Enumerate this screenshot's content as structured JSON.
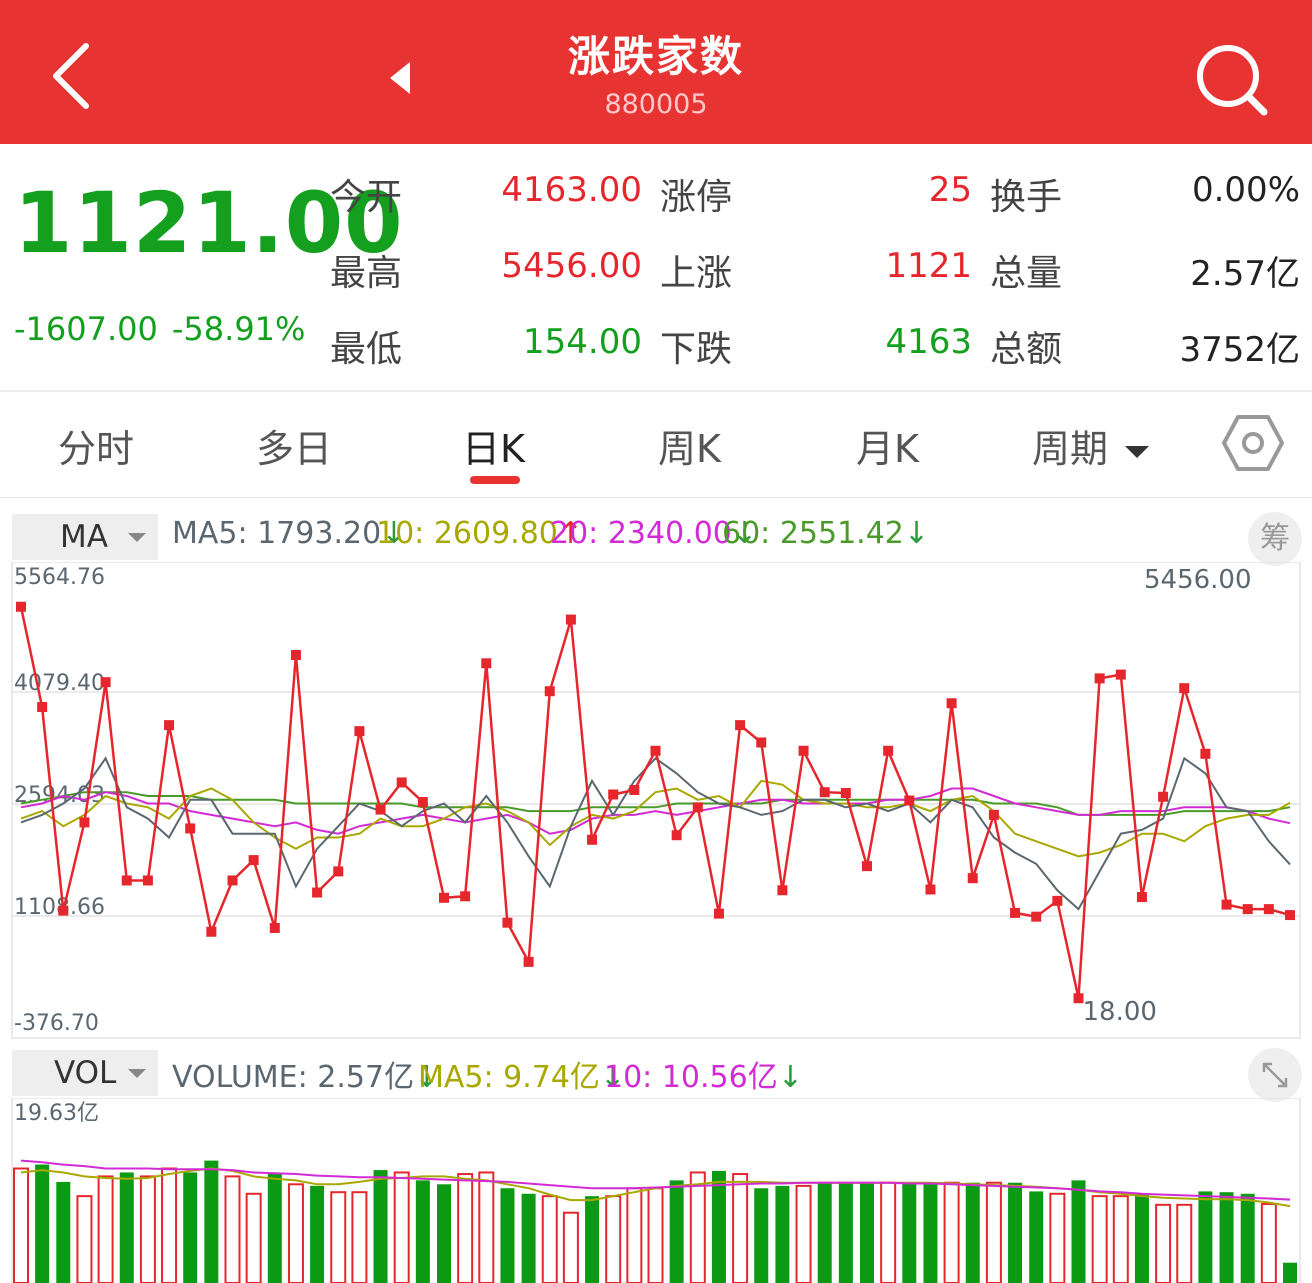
{
  "header": {
    "title": "涨跌家数",
    "code": "880005",
    "bg_color": "#e83333"
  },
  "quote": {
    "price": "1121.00",
    "change": "-1607.00",
    "change_pct": "-58.91%",
    "stats": [
      {
        "label": "今开",
        "value": "4163.00",
        "color": "red"
      },
      {
        "label": "最高",
        "value": "5456.00",
        "color": "red"
      },
      {
        "label": "最低",
        "value": "154.00",
        "color": "green"
      },
      {
        "label": "涨停",
        "value": "25",
        "color": "red"
      },
      {
        "label": "上涨",
        "value": "1121",
        "color": "red"
      },
      {
        "label": "下跌",
        "value": "4163",
        "color": "green"
      },
      {
        "label": "换手",
        "value": "0.00%",
        "color": "black"
      },
      {
        "label": "总量",
        "value": "2.57亿",
        "color": "black"
      },
      {
        "label": "总额",
        "value": "3752亿",
        "color": "black"
      }
    ]
  },
  "tabs": [
    {
      "label": "分时"
    },
    {
      "label": "多日"
    },
    {
      "label": "日K",
      "active": true
    },
    {
      "label": "周K"
    },
    {
      "label": "月K"
    },
    {
      "label": "周期"
    }
  ],
  "ma_bar": {
    "selector": "MA",
    "ma5": "MA5: 1793.20",
    "ma10": "10: 2609.80",
    "ma20": "20: 2340.00",
    "ma60": "60: 2551.42",
    "chip_button": "筹"
  },
  "vol_bar": {
    "selector": "VOL",
    "volume": "VOLUME: 2.57亿",
    "ma5": "MA5: 9.74亿",
    "ma10": "10: 10.56亿"
  },
  "icons": {
    "back": "back-icon",
    "prev": "triangle-left-icon",
    "search": "search-icon",
    "settings": "hexagon-settings-icon",
    "dropdown": "caret-down-icon",
    "expand": "expand-icon"
  },
  "chart_data": [
    {
      "type": "line",
      "title": "",
      "ylim": [
        -376.7,
        5564.76
      ],
      "y_ticks": [
        "5564.76",
        "4079.40",
        "2594.03",
        "1108.66",
        "-376.70"
      ],
      "annotations": {
        "max_label": "5456.00",
        "min_label": "18.00"
      },
      "colors": {
        "main": "#e5272d",
        "ma5": "#5b6770",
        "ma10": "#a8a800",
        "ma20": "#d22bd6",
        "ma60": "#4a9a2a"
      },
      "series": [
        {
          "name": "涨跌家数",
          "values": [
            5210,
            3880,
            1180,
            2350,
            4210,
            1580,
            1580,
            3640,
            2270,
            900,
            1580,
            1850,
            950,
            4570,
            1420,
            1700,
            3560,
            2520,
            2880,
            2620,
            1350,
            1370,
            4460,
            1020,
            500,
            4090,
            5040,
            2120,
            2720,
            2780,
            3300,
            2180,
            2550,
            1140,
            3640,
            3410,
            1450,
            3300,
            2750,
            2740,
            1770,
            3300,
            2640,
            1460,
            3930,
            1610,
            2450,
            1150,
            1100,
            1310,
            18,
            4260,
            4310,
            1360,
            2690,
            4130,
            3260,
            1260,
            1200,
            1200,
            1121
          ]
        },
        {
          "name": "MA5",
          "values": [
            2350,
            2450,
            2600,
            2800,
            3200,
            2550,
            2400,
            2150,
            2650,
            2650,
            2200,
            2200,
            2200,
            1500,
            2000,
            2300,
            2600,
            2500,
            2300,
            2500,
            2600,
            2350,
            2700,
            2350,
            1900,
            1500,
            2300,
            2900,
            2450,
            2900,
            3200,
            3000,
            2750,
            2600,
            2550,
            2450,
            2500,
            2650,
            2650,
            2550,
            2600,
            2500,
            2600,
            2350,
            2650,
            2550,
            2150,
            1950,
            1800,
            1450,
            1200,
            1700,
            2200,
            2250,
            2400,
            3200,
            3000,
            2550,
            2500,
            2100,
            1793.2
          ]
        },
        {
          "name": "MA10",
          "values": [
            2400,
            2500,
            2300,
            2450,
            2700,
            2600,
            2550,
            2400,
            2700,
            2800,
            2650,
            2350,
            2150,
            2000,
            2150,
            2150,
            2200,
            2400,
            2300,
            2300,
            2400,
            2550,
            2600,
            2500,
            2350,
            2050,
            2300,
            2450,
            2400,
            2500,
            2750,
            2800,
            2650,
            2700,
            2550,
            2900,
            2850,
            2650,
            2600,
            2600,
            2550,
            2550,
            2600,
            2500,
            2650,
            2700,
            2500,
            2200,
            2100,
            2000,
            1900,
            1950,
            2050,
            2200,
            2200,
            2100,
            2300,
            2400,
            2450,
            2450,
            2609.8
          ]
        },
        {
          "name": "MA20",
          "values": [
            2550,
            2600,
            2700,
            2650,
            2750,
            2700,
            2600,
            2600,
            2500,
            2450,
            2400,
            2350,
            2300,
            2350,
            2250,
            2200,
            2300,
            2350,
            2400,
            2450,
            2400,
            2350,
            2400,
            2450,
            2350,
            2200,
            2250,
            2400,
            2450,
            2450,
            2500,
            2450,
            2500,
            2550,
            2600,
            2650,
            2650,
            2600,
            2600,
            2600,
            2600,
            2650,
            2650,
            2700,
            2800,
            2800,
            2700,
            2600,
            2550,
            2500,
            2450,
            2450,
            2500,
            2500,
            2500,
            2550,
            2550,
            2550,
            2500,
            2400,
            2340.0
          ]
        },
        {
          "name": "MA60",
          "values": [
            2600,
            2650,
            2700,
            2750,
            2750,
            2750,
            2700,
            2700,
            2700,
            2650,
            2650,
            2650,
            2650,
            2600,
            2600,
            2600,
            2600,
            2600,
            2600,
            2550,
            2550,
            2550,
            2550,
            2550,
            2500,
            2500,
            2500,
            2550,
            2550,
            2550,
            2550,
            2600,
            2600,
            2600,
            2600,
            2600,
            2650,
            2650,
            2650,
            2650,
            2650,
            2650,
            2650,
            2650,
            2650,
            2650,
            2600,
            2600,
            2600,
            2550,
            2450,
            2450,
            2450,
            2450,
            2450,
            2500,
            2500,
            2500,
            2500,
            2500,
            2551.42
          ]
        }
      ]
    },
    {
      "type": "bar",
      "title": "",
      "ylim": [
        0,
        19.63
      ],
      "y_ticks": [
        "19.63亿"
      ],
      "colors": {
        "up": "#e5272d",
        "down": "#0c9a15",
        "ma5": "#a8a800",
        "ma10": "#d22bd6"
      },
      "series": [
        {
          "name": "VOLUME",
          "values": [
            14.5,
            15.0,
            12.8,
            11.0,
            13.5,
            14.0,
            13.5,
            14.5,
            14.0,
            15.5,
            13.5,
            11.3,
            13.8,
            12.5,
            12.3,
            11.5,
            11.5,
            14.3,
            14.0,
            13.0,
            12.5,
            13.8,
            14.0,
            12.0,
            11.3,
            11.0,
            8.9,
            11.0,
            11.0,
            12.0,
            12.0,
            13.0,
            14.0,
            14.2,
            13.8,
            12.0,
            12.3,
            12.3,
            12.7,
            12.7,
            12.7,
            12.7,
            12.7,
            12.7,
            12.7,
            12.7,
            12.7,
            12.7,
            11.6,
            11.3,
            13.0,
            11.0,
            11.0,
            11.3,
            9.9,
            9.9,
            11.6,
            11.5,
            11.3,
            10.0,
            2.57
          ]
        },
        {
          "name": "MA5",
          "values": [
            14.0,
            14.3,
            14.0,
            13.5,
            13.3,
            13.2,
            13.3,
            13.8,
            14.2,
            14.5,
            14.2,
            13.5,
            13.2,
            13.0,
            12.5,
            12.5,
            12.8,
            13.2,
            13.3,
            13.5,
            13.5,
            13.2,
            13.0,
            12.5,
            12.0,
            11.2,
            10.5,
            10.5,
            11.0,
            11.5,
            12.0,
            12.3,
            12.5,
            12.8,
            12.8,
            12.8,
            12.7,
            12.7,
            12.7,
            12.7,
            12.7,
            12.7,
            12.7,
            12.7,
            12.6,
            12.5,
            12.4,
            12.3,
            12.2,
            12.0,
            11.8,
            11.5,
            11.3,
            11.0,
            10.8,
            10.7,
            10.6,
            10.6,
            10.5,
            10.2,
            9.74
          ]
        },
        {
          "name": "10",
          "values": [
            15.5,
            15.3,
            15.0,
            14.8,
            14.5,
            14.5,
            14.5,
            14.4,
            14.4,
            14.4,
            14.3,
            14.0,
            13.9,
            13.8,
            13.6,
            13.5,
            13.4,
            13.4,
            13.3,
            13.2,
            13.1,
            13.0,
            12.9,
            12.8,
            12.6,
            12.4,
            12.2,
            12.0,
            12.0,
            12.0,
            12.1,
            12.2,
            12.3,
            12.4,
            12.5,
            12.6,
            12.6,
            12.7,
            12.7,
            12.7,
            12.7,
            12.7,
            12.6,
            12.6,
            12.5,
            12.4,
            12.3,
            12.2,
            12.1,
            12.0,
            11.8,
            11.6,
            11.5,
            11.3,
            11.2,
            11.1,
            11.0,
            10.9,
            10.8,
            10.7,
            10.56
          ]
        }
      ]
    }
  ]
}
